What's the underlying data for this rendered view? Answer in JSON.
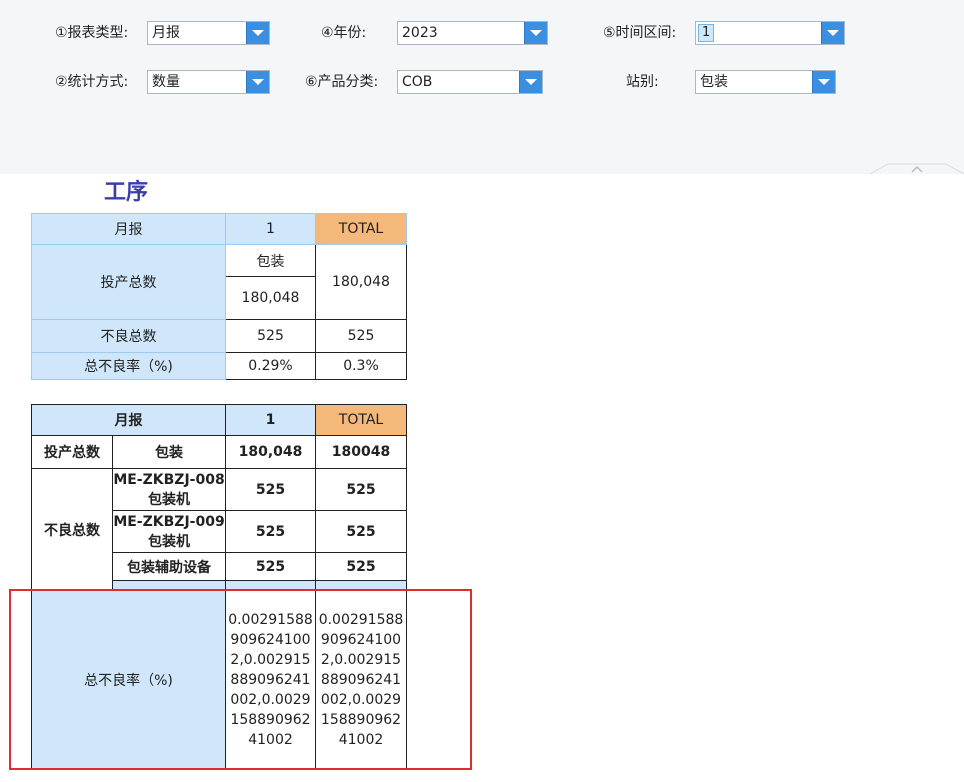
{
  "filters": {
    "report_type": {
      "label": "①报表类型:",
      "value": "月报"
    },
    "year": {
      "label": "④年份:",
      "value": "2023"
    },
    "time_range": {
      "label": "⑤时间区间:",
      "value": "1"
    },
    "stat_method": {
      "label": "②统计方式:",
      "value": "数量"
    },
    "product_category": {
      "label": "⑥产品分类:",
      "value": "COB"
    },
    "station": {
      "label": "站别:",
      "value": "包装"
    }
  },
  "section_title": "工序",
  "table1": {
    "header": {
      "label": "月报",
      "period": "1",
      "total": "TOTAL"
    },
    "output_total": {
      "label": "投产总数",
      "station": "包装",
      "value": "180,048",
      "total": "180,048"
    },
    "defect_total": {
      "label": "不良总数",
      "value": "525",
      "total": "525"
    },
    "defect_rate": {
      "label": "总不良率（%)",
      "value": "0.29%",
      "total": "0.3%"
    }
  },
  "table2": {
    "header": {
      "label": "月报",
      "period": "1",
      "total": "TOTAL"
    },
    "output_total": {
      "label": "投产总数",
      "station": "包装",
      "value": "180,048",
      "total": "180048"
    },
    "defect_total_label": "不良总数",
    "defect_rows": [
      {
        "equipment": "ME-ZKBZJ-008包装机",
        "value": "525",
        "total": "525"
      },
      {
        "equipment": "ME-ZKBZJ-009包装机",
        "value": "525",
        "total": "525"
      },
      {
        "equipment": "包装辅助设备",
        "value": "525",
        "total": "525"
      }
    ],
    "defect_rate": {
      "label": "总不良率（%)",
      "value": "0.002915889096241002,0.002915889096241002,0.002915889096241002",
      "total": "0.002915889096241002,0.002915889096241002,0.002915889096241002"
    }
  },
  "colors": {
    "header_blue": "#cfe6fb",
    "total_orange": "#f4b97a",
    "dropdown_blue": "#3a8fe0",
    "title_purple": "#3a3fa8",
    "highlight_red": "#e12c2c"
  }
}
